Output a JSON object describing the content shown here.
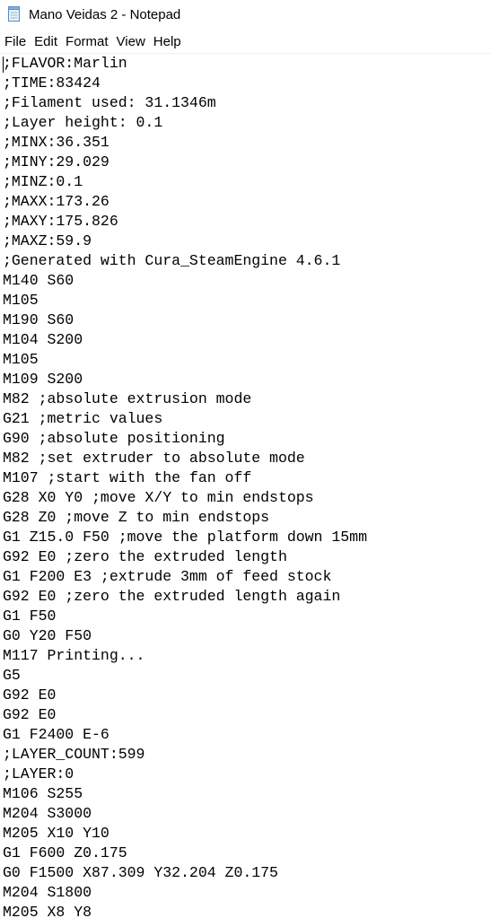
{
  "window": {
    "title": "Mano Veidas 2 - Notepad",
    "icon": "notepad-icon"
  },
  "menu": {
    "items": [
      "File",
      "Edit",
      "Format",
      "View",
      "Help"
    ]
  },
  "document": {
    "lines": [
      ";FLAVOR:Marlin",
      ";TIME:83424",
      ";Filament used: 31.1346m",
      ";Layer height: 0.1",
      ";MINX:36.351",
      ";MINY:29.029",
      ";MINZ:0.1",
      ";MAXX:173.26",
      ";MAXY:175.826",
      ";MAXZ:59.9",
      ";Generated with Cura_SteamEngine 4.6.1",
      "M140 S60",
      "M105",
      "M190 S60",
      "M104 S200",
      "M105",
      "M109 S200",
      "M82 ;absolute extrusion mode",
      "G21 ;metric values",
      "G90 ;absolute positioning",
      "M82 ;set extruder to absolute mode",
      "M107 ;start with the fan off",
      "G28 X0 Y0 ;move X/Y to min endstops",
      "G28 Z0 ;move Z to min endstops",
      "G1 Z15.0 F50 ;move the platform down 15mm",
      "G92 E0 ;zero the extruded length",
      "G1 F200 E3 ;extrude 3mm of feed stock",
      "G92 E0 ;zero the extruded length again",
      "G1 F50",
      "G0 Y20 F50",
      "M117 Printing...",
      "G5",
      "G92 E0",
      "G92 E0",
      "G1 F2400 E-6",
      ";LAYER_COUNT:599",
      ";LAYER:0",
      "M106 S255",
      "M204 S3000",
      "M205 X10 Y10",
      "G1 F600 Z0.175",
      "G0 F1500 X87.309 Y32.204 Z0.175",
      "M204 S1800",
      "M205 X8 Y8"
    ]
  }
}
